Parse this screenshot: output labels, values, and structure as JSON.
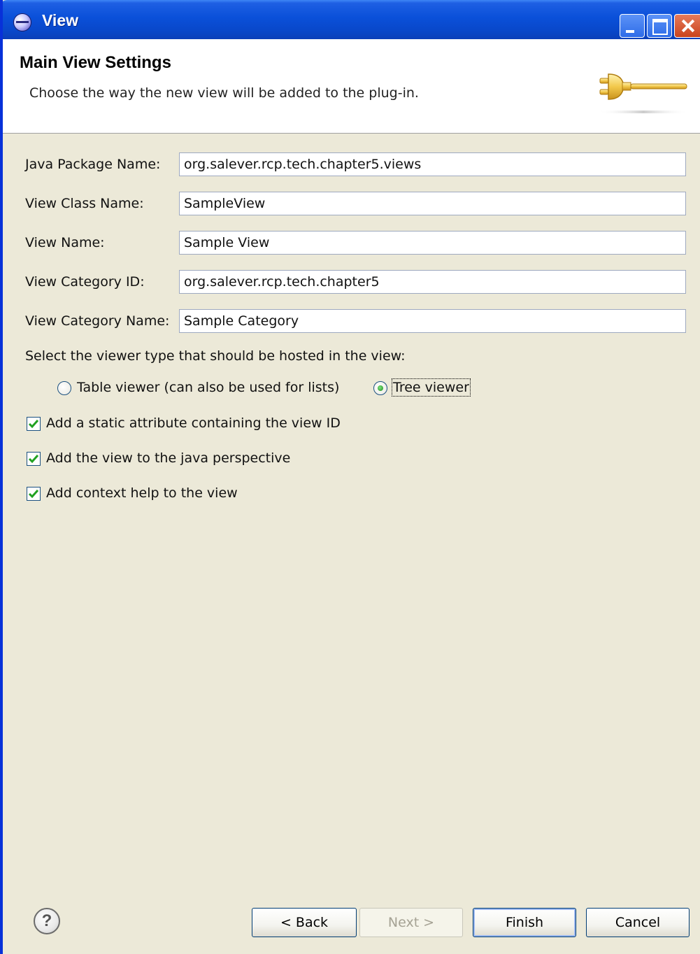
{
  "window": {
    "title": "View"
  },
  "header": {
    "title": "Main View Settings",
    "description": "Choose the way the new view will be added to the plug-in."
  },
  "form": {
    "fields": [
      {
        "label": "Java Package Name:",
        "value": "org.salever.rcp.tech.chapter5.views"
      },
      {
        "label": "View Class Name:",
        "value": "SampleView"
      },
      {
        "label": "View Name:",
        "value": "Sample View"
      },
      {
        "label": "View Category ID:",
        "value": "org.salever.rcp.tech.chapter5"
      },
      {
        "label": "View Category Name:",
        "value": "Sample Category"
      }
    ],
    "viewer_prompt": "Select the viewer type that should be hosted in the view:",
    "viewer_options": [
      {
        "label": "Table viewer (can also be used for lists)",
        "selected": false
      },
      {
        "label": "Tree viewer",
        "selected": true
      }
    ],
    "checkboxes": [
      {
        "label": "Add a static attribute containing the view ID",
        "checked": true
      },
      {
        "label": "Add the view to the java perspective",
        "checked": true
      },
      {
        "label": "Add context help to the view",
        "checked": true
      }
    ]
  },
  "footer": {
    "help_symbol": "?",
    "back_label": "< Back",
    "next_label": "Next >",
    "finish_label": "Finish",
    "cancel_label": "Cancel"
  }
}
